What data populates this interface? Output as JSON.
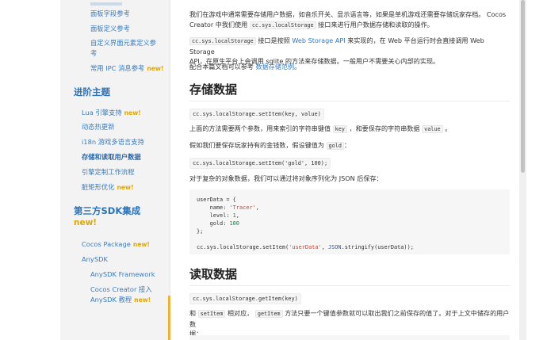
{
  "sidebar": {
    "top_items": [
      {
        "label": "面板字段参考"
      },
      {
        "label": "面板定义参考"
      },
      {
        "label": "自定义界面元素定义参"
      },
      {
        "label": "考"
      },
      {
        "label": "常用 IPC 消息参考",
        "badge": "new!"
      }
    ],
    "advanced": {
      "title": "进阶主题",
      "items": [
        {
          "label": "Lua 引擎支持",
          "badge": "new!"
        },
        {
          "label": "动态热更新"
        },
        {
          "label": "i18n 游戏多语言支持"
        },
        {
          "label": "存储和读取用户数据"
        },
        {
          "label": "引擎定制工作流程"
        },
        {
          "label": "脏矩形优化",
          "badge": "new!"
        }
      ]
    },
    "sdk": {
      "title": "第三方SDK集成",
      "badge": "new!",
      "items": [
        {
          "label": "Cocos Package",
          "badge": "new!"
        },
        {
          "label": "AnySDK"
        },
        {
          "label": "AnySDK Framework"
        },
        {
          "label": "Cocos Creator 接入"
        },
        {
          "label": "AnySDK 教程",
          "badge": "new!"
        }
      ]
    }
  },
  "content": {
    "intro_line1": "我们在游戏中通常需要存储用户数据，如音乐开关、显示语言等，如果是单机游戏还需要存储玩家存档。 Cocos",
    "intro_line2_a": "Creator 中我们使用 ",
    "intro_code": "cc.sys.localStorage",
    "intro_line2_b": " 接口来进行用户数据存储和读取的操作。",
    "api_code": "cc.sys.localStorage",
    "api_text_a": " 接口是按照 ",
    "api_link": "Web Storage API",
    "api_text_b": " 来实现的，在 Web 平台运行时会直接调用 Web Storage",
    "api_line2": "API，在原生平台上会调用 sqlite 的方法来存储数据。一般用户不需要关心内部的实现。",
    "sample_text": "配合本篇文档可以参考 ",
    "sample_link": "数据存储范例",
    "sample_end": "。",
    "h_store": "存储数据",
    "set_code": "cc.sys.localStorage.setItem(key, value)",
    "set_desc_a": "上面的方法需要两个参数，用来索引的字符串键值 ",
    "set_desc_key": "key",
    "set_desc_b": " ，和要保存的字符串数据 ",
    "set_desc_value": "value",
    "set_desc_c": " 。",
    "gold_desc_a": "假如我们要保存玩家持有的金钱数，假设键值为 ",
    "gold_desc_key": "gold",
    "gold_desc_b": "：",
    "gold_code": "cc.sys.localStorage.setItem('gold', 100);",
    "obj_desc": "对于复杂的对象数据，我们可以通过将对象序列化为 JSON 后保存：",
    "block": {
      "l1": "userData = {",
      "l2a": "    name: ",
      "l2s": "'Tracer'",
      "l2b": ",",
      "l3a": "    level: ",
      "l3n": "1",
      "l3b": ",",
      "l4a": "    gold: ",
      "l4n": "100",
      "l5": "};",
      "l7a": "cc.sys.localStorage.setItem(",
      "l7s": "'userData'",
      "l7b": ", ",
      "l7k": "JSON",
      "l7c": ".stringify(userData));"
    },
    "h_read": "读取数据",
    "get_code": "cc.sys.localStorage.getItem(key)",
    "read_desc_a": "和 ",
    "read_desc_set": "setItem",
    "read_desc_b": " 相对应， ",
    "read_desc_get": "getItem",
    "read_desc_c": " 方法只要一个键值参数就可以取出我们之前保存的值了。对于上文中储存的用户数",
    "read_desc_line2": "据："
  }
}
